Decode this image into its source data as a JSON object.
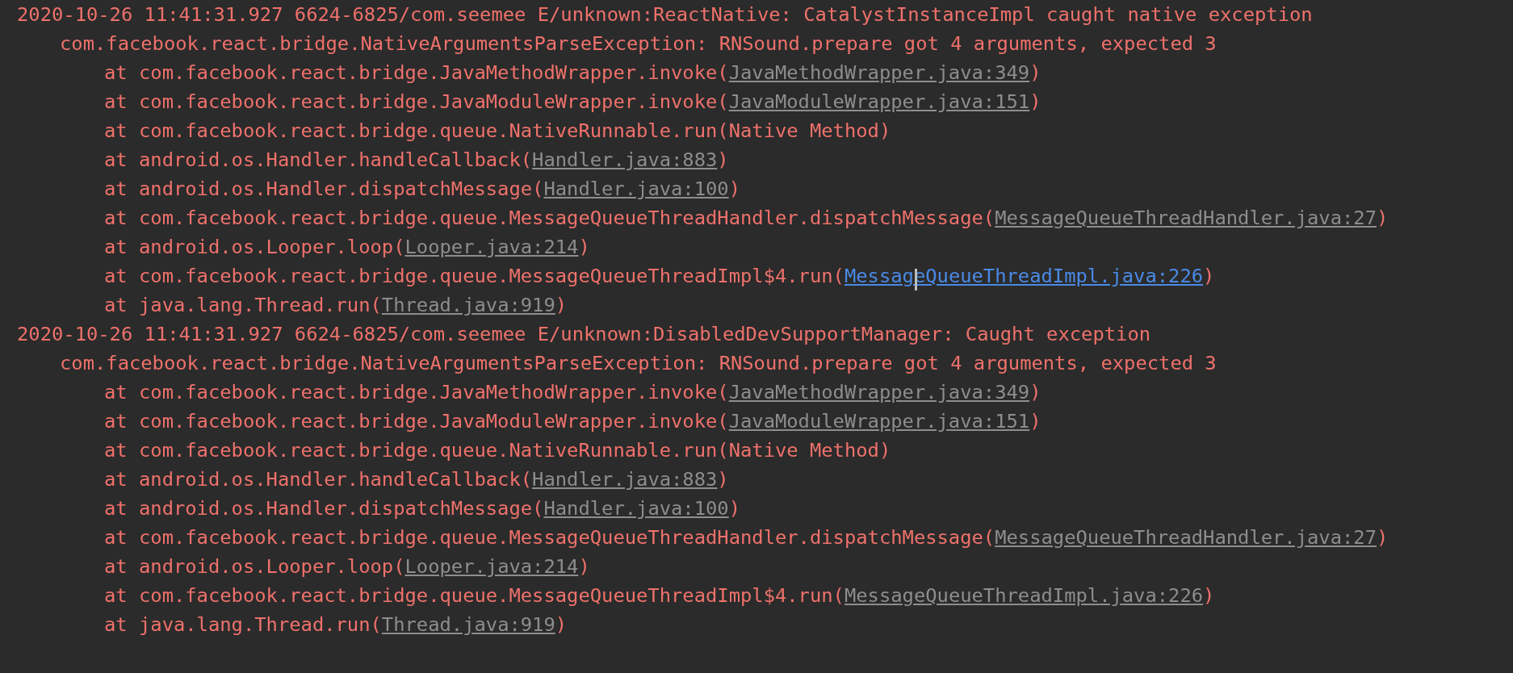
{
  "log_entries": [
    {
      "header": "2020-10-26 11:41:31.927 6624-6825/com.seemee E/unknown:ReactNative: CatalystInstanceImpl caught native exception",
      "exception": "com.facebook.react.bridge.NativeArgumentsParseException: RNSound.prepare got 4 arguments, expected 3",
      "frames": [
        {
          "call": "at com.facebook.react.bridge.JavaMethodWrapper.invoke(",
          "link": {
            "text": "JavaMethodWrapper.java:349",
            "hovered": false
          },
          "end": ")"
        },
        {
          "call": "at com.facebook.react.bridge.JavaModuleWrapper.invoke(",
          "link": {
            "text": "JavaModuleWrapper.java:151",
            "hovered": false
          },
          "end": ")"
        },
        {
          "call": "at com.facebook.react.bridge.queue.NativeRunnable.run(Native Method)"
        },
        {
          "call": "at android.os.Handler.handleCallback(",
          "link": {
            "text": "Handler.java:883",
            "hovered": false
          },
          "end": ")"
        },
        {
          "call": "at android.os.Handler.dispatchMessage(",
          "link": {
            "text": "Handler.java:100",
            "hovered": false
          },
          "end": ")"
        },
        {
          "call": "at com.facebook.react.bridge.queue.MessageQueueThreadHandler.dispatchMessage(",
          "link": {
            "text": "MessageQueueThreadHandler.java:27",
            "hovered": false
          },
          "end": ")"
        },
        {
          "call": "at android.os.Looper.loop(",
          "link": {
            "text": "Looper.java:214",
            "hovered": false
          },
          "end": ")"
        },
        {
          "call": "at com.facebook.react.bridge.queue.MessageQueueThreadImpl$4.run(",
          "link": {
            "text": "MessageQueueThreadImpl.java:226",
            "hovered": true
          },
          "end": ")"
        },
        {
          "call": "at java.lang.Thread.run(",
          "link": {
            "text": "Thread.java:919",
            "hovered": false
          },
          "end": ")"
        }
      ]
    },
    {
      "header": "2020-10-26 11:41:31.927 6624-6825/com.seemee E/unknown:DisabledDevSupportManager: Caught exception",
      "exception": "com.facebook.react.bridge.NativeArgumentsParseException: RNSound.prepare got 4 arguments, expected 3",
      "frames": [
        {
          "call": "at com.facebook.react.bridge.JavaMethodWrapper.invoke(",
          "link": {
            "text": "JavaMethodWrapper.java:349",
            "hovered": false
          },
          "end": ")"
        },
        {
          "call": "at com.facebook.react.bridge.JavaModuleWrapper.invoke(",
          "link": {
            "text": "JavaModuleWrapper.java:151",
            "hovered": false
          },
          "end": ")"
        },
        {
          "call": "at com.facebook.react.bridge.queue.NativeRunnable.run(Native Method)"
        },
        {
          "call": "at android.os.Handler.handleCallback(",
          "link": {
            "text": "Handler.java:883",
            "hovered": false
          },
          "end": ")"
        },
        {
          "call": "at android.os.Handler.dispatchMessage(",
          "link": {
            "text": "Handler.java:100",
            "hovered": false
          },
          "end": ")"
        },
        {
          "call": "at com.facebook.react.bridge.queue.MessageQueueThreadHandler.dispatchMessage(",
          "link": {
            "text": "MessageQueueThreadHandler.java:27",
            "hovered": false
          },
          "end": ")"
        },
        {
          "call": "at android.os.Looper.loop(",
          "link": {
            "text": "Looper.java:214",
            "hovered": false
          },
          "end": ")"
        },
        {
          "call": "at com.facebook.react.bridge.queue.MessageQueueThreadImpl$4.run(",
          "link": {
            "text": "MessageQueueThreadImpl.java:226",
            "hovered": false
          },
          "end": ")"
        },
        {
          "call": "at java.lang.Thread.run(",
          "link": {
            "text": "Thread.java:919",
            "hovered": false
          },
          "end": ")"
        }
      ]
    }
  ]
}
